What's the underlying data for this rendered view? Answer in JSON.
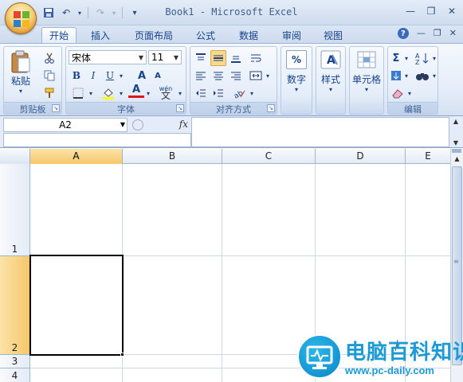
{
  "window": {
    "title": "Book1 - Microsoft Excel",
    "qat": {
      "save": "save-icon",
      "undo": "↶",
      "redo": "↷",
      "customize": "▾"
    },
    "controls": {
      "minimize": "—",
      "restore": "❐",
      "close": "✕"
    }
  },
  "tabs": [
    {
      "label": "开始",
      "active": true
    },
    {
      "label": "插入",
      "active": false
    },
    {
      "label": "页面布局",
      "active": false
    },
    {
      "label": "公式",
      "active": false
    },
    {
      "label": "数据",
      "active": false
    },
    {
      "label": "审阅",
      "active": false
    },
    {
      "label": "视图",
      "active": false
    }
  ],
  "ribbon": {
    "clipboard": {
      "label": "剪贴板",
      "paste": "粘贴"
    },
    "font": {
      "label": "字体",
      "font_name": "宋体",
      "font_size": "11",
      "bold": "B",
      "italic": "I",
      "underline": "U",
      "grow": "A",
      "shrink": "A",
      "font_color": "A",
      "phonetic": "wén"
    },
    "alignment": {
      "label": "对齐方式"
    },
    "number": {
      "label": "数字",
      "icon": "%"
    },
    "styles": {
      "label": "样式"
    },
    "cells": {
      "label": "单元格"
    },
    "editing": {
      "label": "编辑",
      "sum": "Σ"
    }
  },
  "formula_bar": {
    "name_box": "A2",
    "fx": "fx",
    "value": ""
  },
  "grid": {
    "columns": [
      "A",
      "B",
      "C",
      "D",
      "E"
    ],
    "rows": [
      "1",
      "2",
      "3",
      "4"
    ],
    "selected_column": "A",
    "selected_row": "2",
    "active_cell": "A2"
  },
  "watermark": {
    "title": "电脑百科知识",
    "url": "www.pc-daily.com"
  },
  "colors": {
    "accent": "#15428b",
    "selection": "#f6c76b",
    "ribbon_bg": "#e3ecf8"
  }
}
